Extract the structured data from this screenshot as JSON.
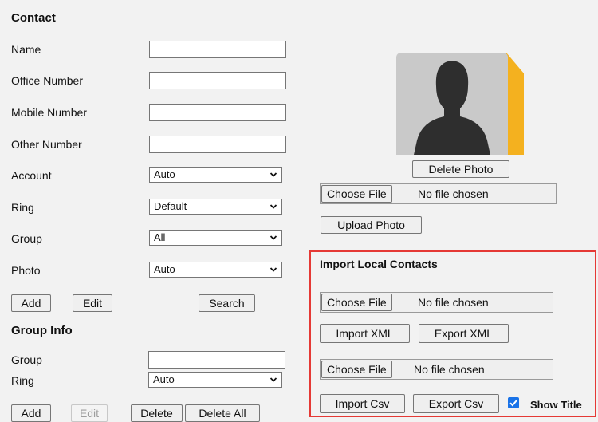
{
  "contact": {
    "title": "Contact",
    "fields": [
      {
        "label": "Name",
        "value": ""
      },
      {
        "label": "Office Number",
        "value": ""
      },
      {
        "label": "Mobile Number",
        "value": ""
      },
      {
        "label": "Other Number",
        "value": ""
      }
    ],
    "account": {
      "label": "Account",
      "value": "Auto"
    },
    "ring": {
      "label": "Ring",
      "value": "Default"
    },
    "group": {
      "label": "Group",
      "value": "All"
    },
    "photo": {
      "label": "Photo",
      "value": "Auto"
    },
    "buttons": {
      "add": "Add",
      "edit": "Edit",
      "search": "Search"
    }
  },
  "photo_panel": {
    "delete_photo": "Delete Photo",
    "choose_file": "Choose File",
    "no_file": "No file chosen",
    "upload_photo": "Upload Photo",
    "accent_color": "#f4b11f"
  },
  "import_local": {
    "title": "Import Local Contacts",
    "choose_file_1": "Choose File",
    "no_file_1": "No file chosen",
    "import_xml": "Import XML",
    "export_xml": "Export XML",
    "choose_file_2": "Choose File",
    "no_file_2": "No file chosen",
    "import_csv": "Import Csv",
    "export_csv": "Export Csv",
    "show_title": "Show Title",
    "show_title_checked": true,
    "highlight_color": "#e53935"
  },
  "group_info": {
    "title": "Group Info",
    "group_label": "Group",
    "group_value": "",
    "ring_label": "Ring",
    "ring_value": "Auto",
    "buttons": {
      "add": "Add",
      "edit": "Edit",
      "delete": "Delete",
      "delete_all": "Delete All"
    }
  }
}
